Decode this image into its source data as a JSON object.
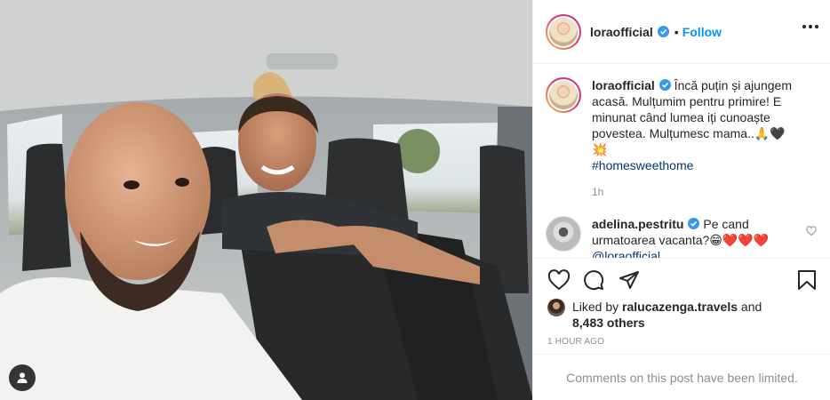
{
  "post": {
    "author": "loraofficial",
    "follow_label": "Follow",
    "separator": "•"
  },
  "caption": {
    "username": "loraofficial",
    "text": " Încă puțin și ajungem acasă. Mulțumim pentru primire! E minunat când lumea iți cunoaște povestea. Mulțumesc mama..🙏🖤💥",
    "hashtag": "#homesweethome",
    "time": "1h"
  },
  "comment": {
    "username": "adelina.pestritu",
    "text": " Pe cand urmatoarea vacanta?😁❤️❤️❤️",
    "mention": "@loraofficial"
  },
  "likes": {
    "prefix": "Liked by ",
    "user": "ralucazenga.travels",
    "middle": " and",
    "others": "8,483 others"
  },
  "timestamp": "1 HOUR AGO",
  "comments_limited": "Comments on this post have been limited.",
  "icons": [
    "heart-icon",
    "comment-icon",
    "share-icon",
    "save-icon",
    "more-icon",
    "verified-icon",
    "user-tag-icon"
  ],
  "colors": {
    "link": "#0095f6",
    "verified": "#3897f0",
    "muted": "#8e8e8e",
    "text": "#262626"
  }
}
